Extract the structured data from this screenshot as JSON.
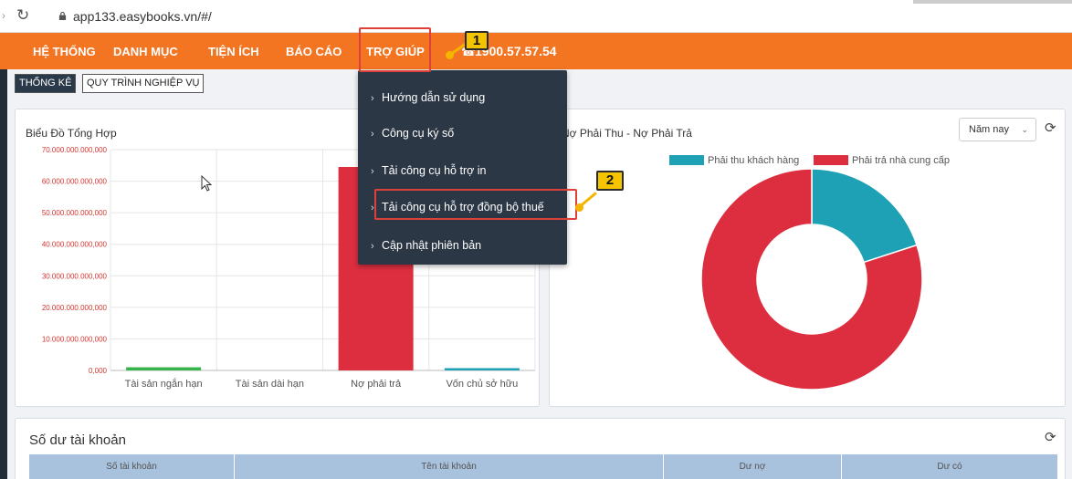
{
  "browser": {
    "url": "app133.easybooks.vn/#/"
  },
  "nav": {
    "items": [
      "HỆ THỐNG",
      "DANH MỤC",
      "TIỆN ÍCH",
      "BÁO CÁO",
      "TRỢ GIÚP"
    ],
    "phone": "1900.57.57.54"
  },
  "tabs": {
    "stats": "THỐNG KÊ",
    "process": "QUY TRÌNH NGHIỆP VỤ"
  },
  "help_menu": {
    "items": [
      "Hướng dẫn sử dụng",
      "Công cụ ký số",
      "Tải công cụ hỗ trợ in",
      "Tải công cụ hỗ trợ đồng bộ thuế",
      "Cập nhật phiên bản"
    ]
  },
  "callouts": {
    "one": "1",
    "two": "2"
  },
  "bar_panel": {
    "title": "Biểu Đồ Tổng Hợp"
  },
  "donut_panel": {
    "title": "Nợ Phải Thu - Nợ Phải Trả",
    "period": "Năm nay"
  },
  "balance": {
    "title": "Số dư tài khoản",
    "columns": [
      "Số tài khoản",
      "Tên tài khoản",
      "Dư nợ",
      "Dư có"
    ]
  },
  "chart_data": [
    {
      "type": "bar",
      "title": "Biểu Đồ Tổng Hợp",
      "categories": [
        "Tài sản ngắn hạn",
        "Tài sản dài hạn",
        "Nợ phải trả",
        "Vốn chủ sở hữu"
      ],
      "values": [
        1000000000,
        0,
        64500000000,
        300000000
      ],
      "colors": [
        "#36b34a",
        "#36b34a",
        "#dc2e3f",
        "#1ea1b5"
      ],
      "ylim": [
        0,
        70000000000
      ],
      "yticks": [
        "0,000",
        "10.000.000.000,000",
        "20.000.000.000,000",
        "30.000.000.000,000",
        "40.000.000.000,000",
        "50.000.000.000,000",
        "60.000.000.000,000",
        "70.000.000.000,000"
      ],
      "grid": true
    },
    {
      "type": "pie",
      "title": "Nợ Phải Thu - Nợ Phải Trả",
      "series": [
        {
          "name": "Phải thu khách hàng",
          "value": 20,
          "color": "#1ea1b5"
        },
        {
          "name": "Phải trả nhà cung cấp",
          "value": 80,
          "color": "#dc2e3f"
        }
      ],
      "legend": "top"
    }
  ]
}
